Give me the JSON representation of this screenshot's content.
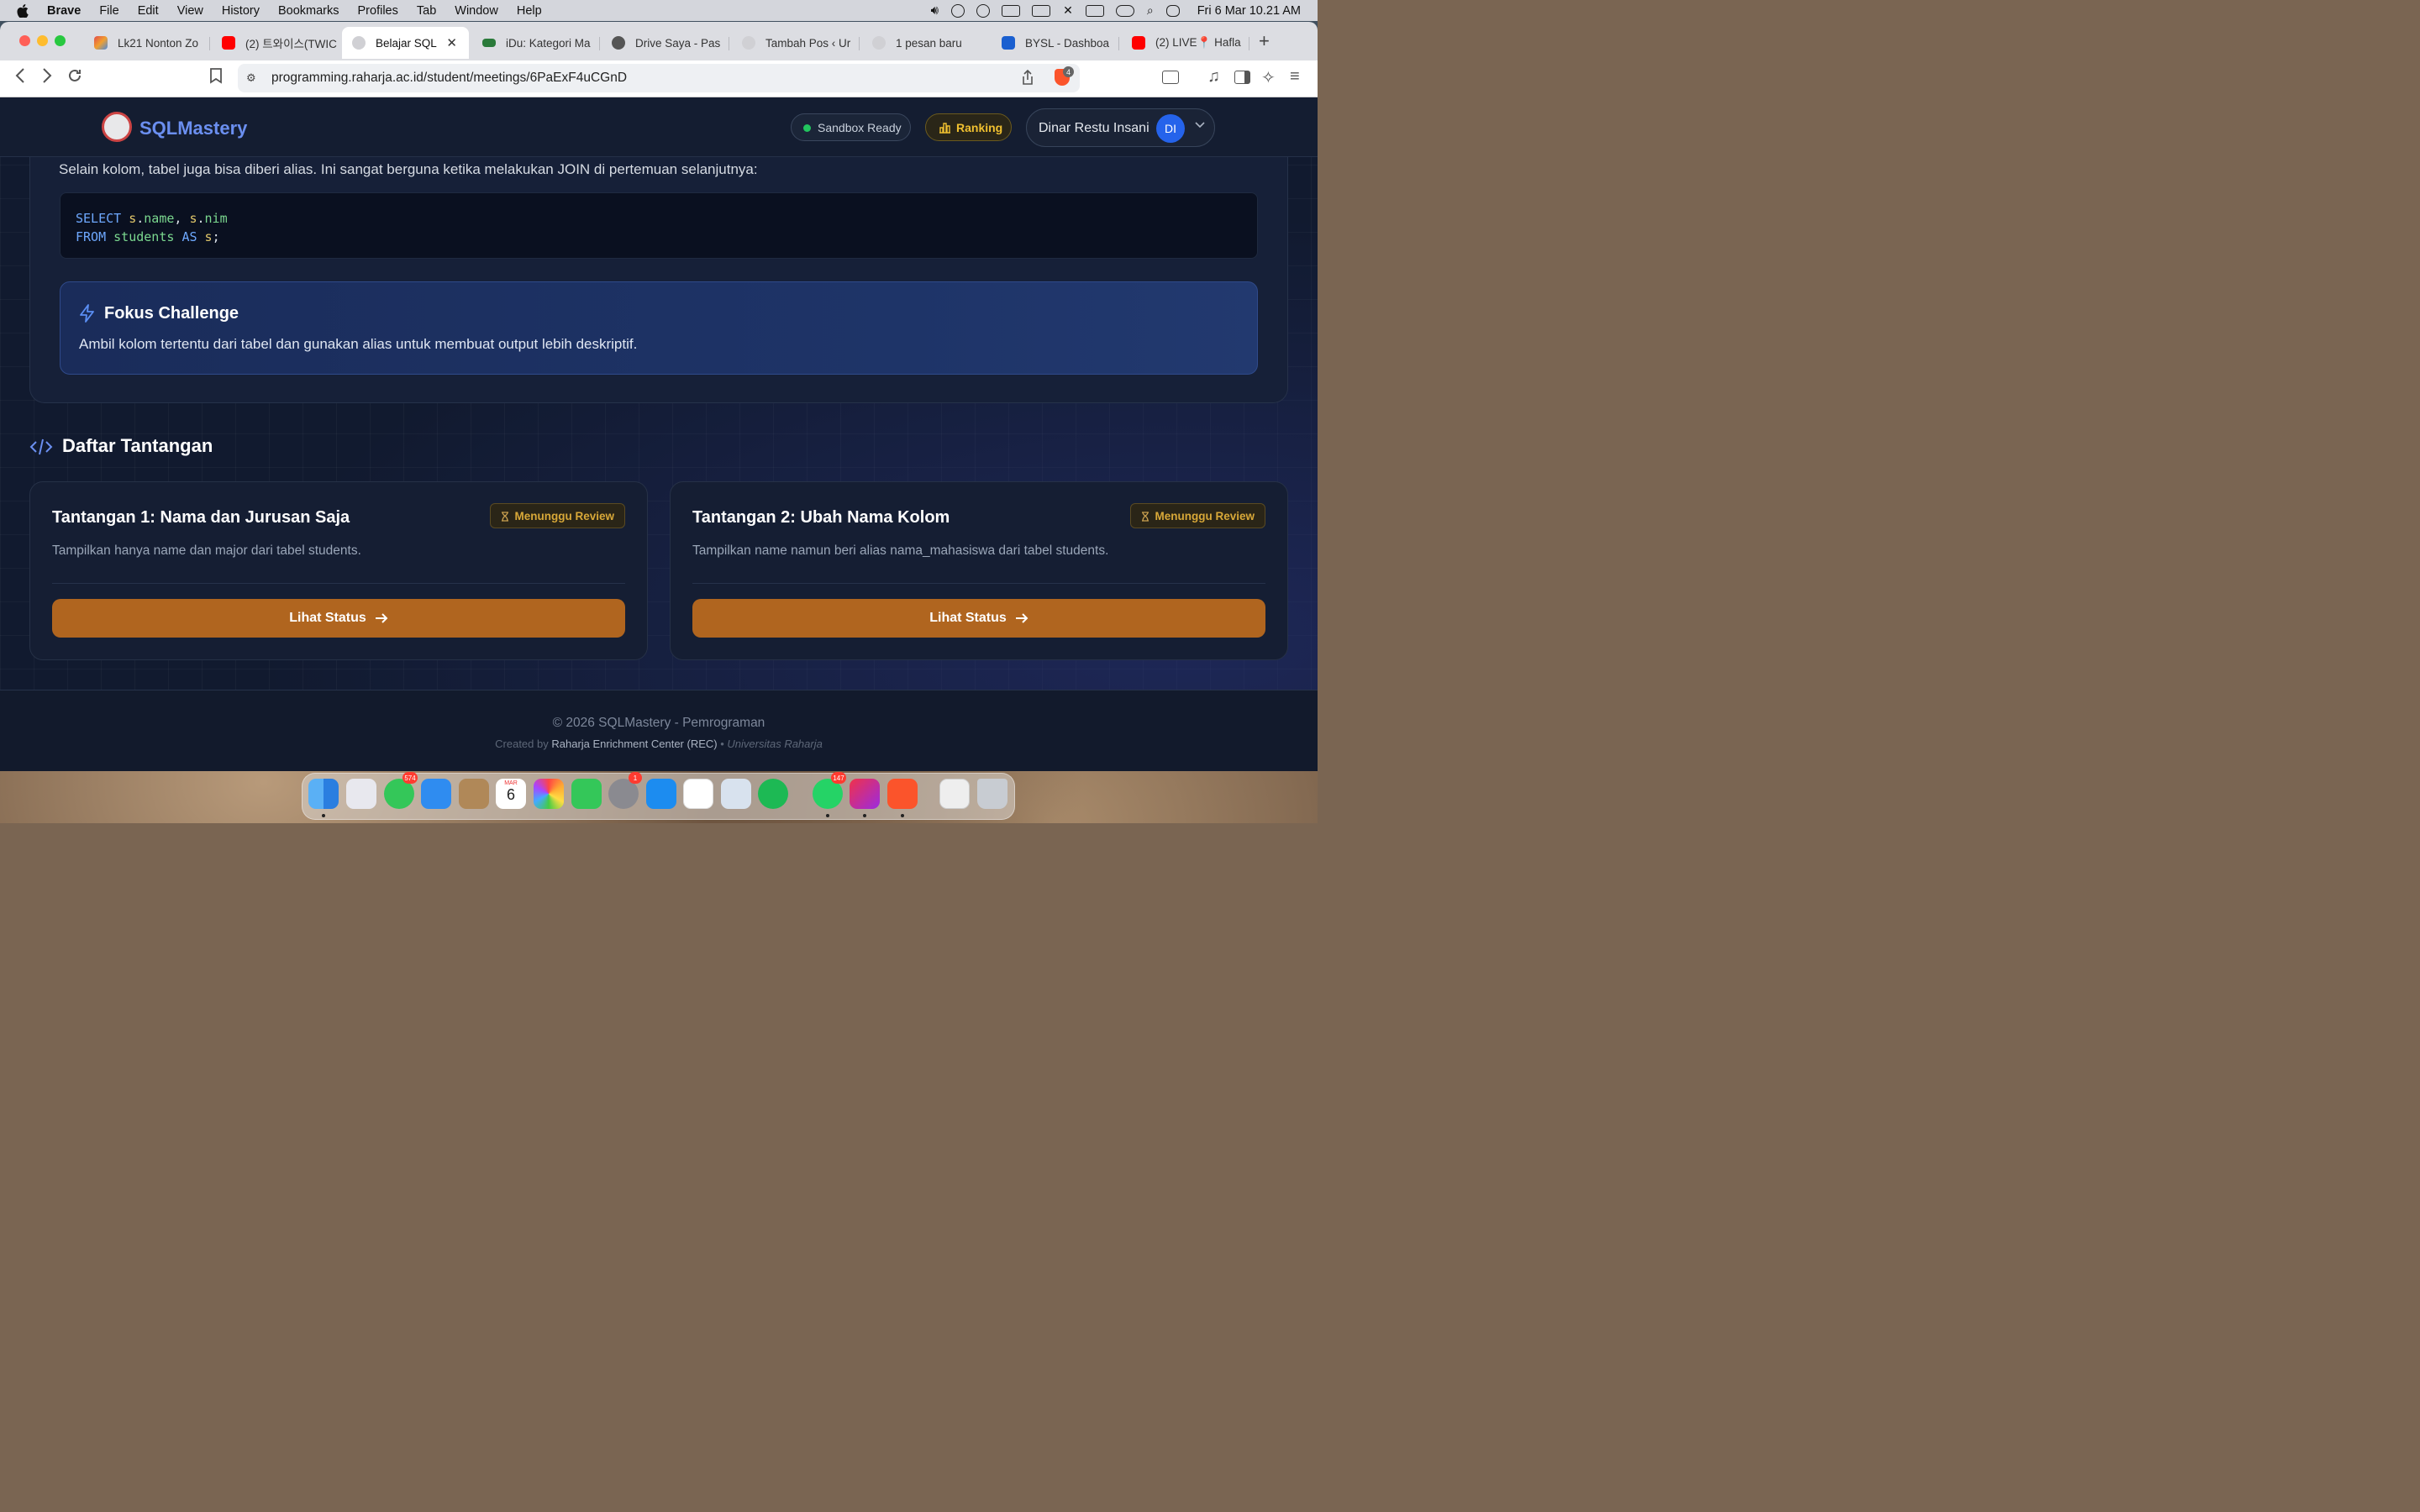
{
  "menubar": {
    "app": "Brave",
    "items": [
      "File",
      "Edit",
      "View",
      "History",
      "Bookmarks",
      "Profiles",
      "Tab",
      "Window",
      "Help"
    ],
    "clock": "Fri 6 Mar  10.21 AM"
  },
  "tabs": [
    {
      "label": "Lk21 Nonton Zo",
      "icon": "lk21-favicon",
      "color": "#e24a4a"
    },
    {
      "label": "(2) 트와이스(TWIC",
      "icon": "youtube-favicon",
      "color": "#ff0000"
    },
    {
      "label": "Belajar SQL",
      "icon": "raharja-favicon",
      "color": "#c8c8cc",
      "active": true
    },
    {
      "label": "iDu: Kategori Ma",
      "icon": "idu-favicon",
      "color": "#2a7a3a"
    },
    {
      "label": "Drive Saya - Pas",
      "icon": "globe-favicon",
      "color": "#555"
    },
    {
      "label": "Tambah Pos ‹ Ur",
      "icon": "raharja-favicon",
      "color": "#c8c8cc"
    },
    {
      "label": "1 pesan baru",
      "icon": "raharja-favicon",
      "color": "#c8c8cc"
    },
    {
      "label": "BYSL - Dashboa",
      "icon": "bysl-favicon",
      "color": "#1a5fd0"
    },
    {
      "label": "(2) LIVE📍 Hafla",
      "icon": "youtube-favicon",
      "color": "#ff0000"
    }
  ],
  "browser": {
    "url": "programming.raharja.ac.id/student/meetings/6PaExF4uCGnD",
    "shield_count": "4"
  },
  "app": {
    "brand": "SQLMastery",
    "sandbox": "Sandbox Ready",
    "ranking": "Ranking",
    "user_name": "Dinar Restu Insani",
    "user_initials": "DI"
  },
  "lesson": {
    "intro": "Selain kolom, tabel juga bisa diberi alias. Ini sangat berguna ketika melakukan JOIN di pertemuan selanjutnya:",
    "code": {
      "l1_kw": "SELECT",
      "l1_a": "s",
      "l1_dot1": ".",
      "l1_b": "name",
      "l1_comma": ", ",
      "l1_c": "s",
      "l1_dot2": ".",
      "l1_d": "nim",
      "l2_kw": "FROM",
      "l2_table": "students",
      "l2_as": "AS",
      "l2_alias": "s",
      "l2_end": ";"
    },
    "focus_title": "Fokus Challenge",
    "focus_text": "Ambil kolom tertentu dari tabel dan gunakan alias untuk membuat output lebih deskriptif."
  },
  "challenges": {
    "title": "Daftar Tantangan",
    "items": [
      {
        "title": "Tantangan 1: Nama dan Jurusan Saja",
        "status": "Menunggu Review",
        "desc": "Tampilkan hanya name dan major dari tabel students.",
        "button": "Lihat Status"
      },
      {
        "title": "Tantangan 2: Ubah Nama Kolom",
        "status": "Menunggu Review",
        "desc": "Tampilkan name namun beri alias nama_mahasiswa dari tabel students.",
        "button": "Lihat Status"
      }
    ]
  },
  "footer": {
    "copyright": "© 2026 SQLMastery - Pemrograman",
    "created_by": "Created by",
    "org": "Raharja Enrichment Center (REC)",
    "bullet": "•",
    "university": "Universitas Raharja"
  },
  "dock": {
    "messages_badge": "574",
    "settings_badge": "1",
    "whatsapp_badge": "147",
    "calendar_month": "MAR",
    "calendar_day": "6"
  }
}
